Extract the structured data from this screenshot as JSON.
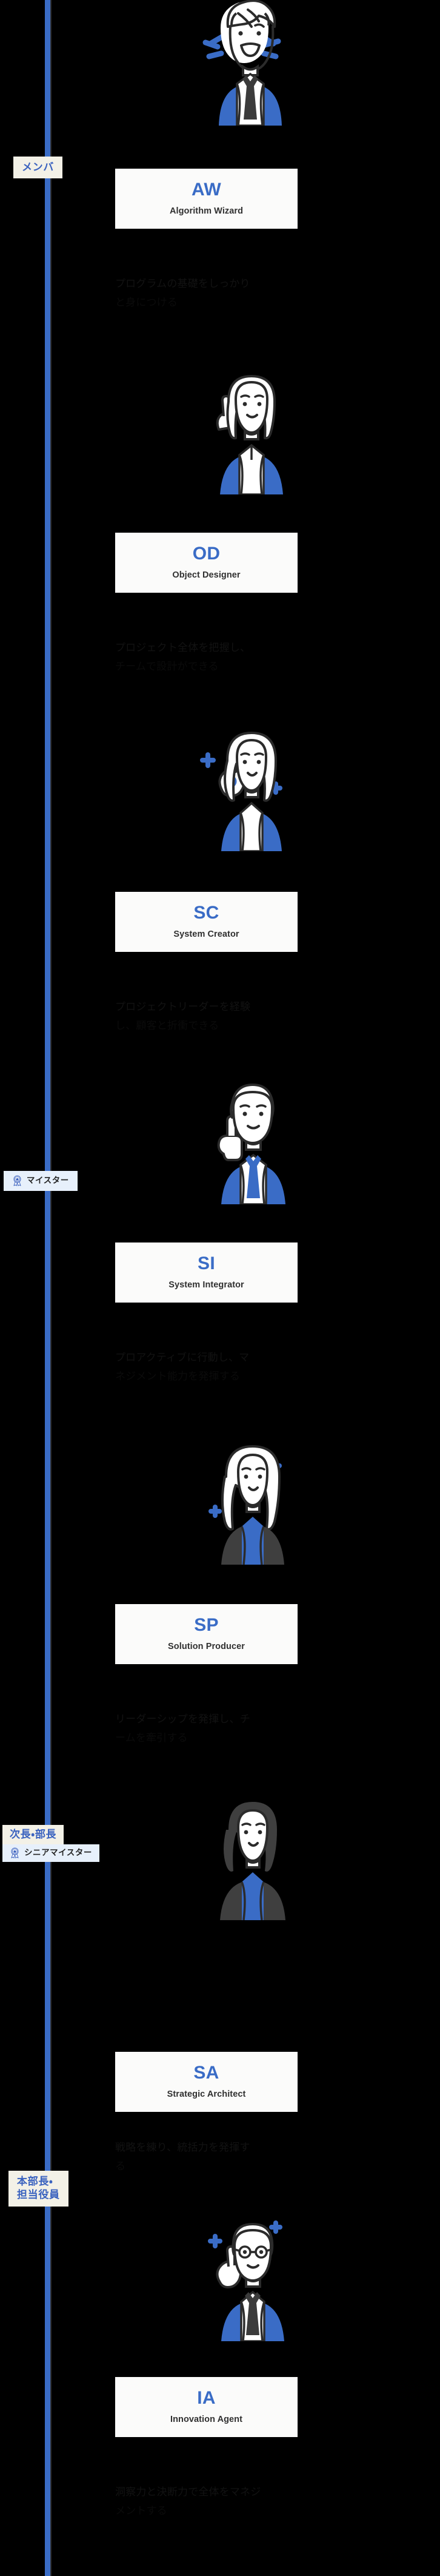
{
  "page": {
    "title": "キャリアステップ",
    "background_color": "#000000",
    "accent_color": "#3a6cc6",
    "rail_color": "#3a6cc6",
    "badge_cream_bg": "#f3f1e7",
    "badge_cream_text": "#3a62bf",
    "badge_ice_bg": "#e7f0fb",
    "badge_ice_text": "#232323",
    "card_bg": "#fbfbfa",
    "card_abbr_color": "#3a6cc6",
    "card_name_color": "#303030"
  },
  "badges": [
    {
      "id": "member",
      "rows": [
        {
          "style": "cream",
          "label": "メンバ",
          "icon": null
        }
      ]
    },
    {
      "id": "meister",
      "rows": [
        {
          "style": "ice",
          "label": "マイスター",
          "icon": "medal-ribbon-icon"
        }
      ]
    },
    {
      "id": "senior-meister",
      "rows": [
        {
          "style": "cream",
          "label": "次長・部長",
          "icon": null
        },
        {
          "style": "ice",
          "label": "シニアマイスター",
          "icon": "medal-ribbon-icon"
        }
      ]
    },
    {
      "id": "executive",
      "rows": [
        {
          "style": "cream",
          "label_line1": "本部長・",
          "label_line2": "担当役員",
          "icon": null
        }
      ]
    }
  ],
  "roles": [
    {
      "abbr": "AW",
      "name": "Algorithm Wizard",
      "desc_line1": "プログラムの基礎をしっかり",
      "desc_line2": "と身につける",
      "avatar": "avatar-excited-man-icon"
    },
    {
      "abbr": "OD",
      "name": "Object Designer",
      "desc_line1": "プロジェクト全体を把握し、",
      "desc_line2": "チームで設計ができる",
      "avatar": "avatar-pointing-woman-icon"
    },
    {
      "abbr": "SC",
      "name": "System Creator",
      "desc_line1": "プロジェクトリーダーを経験",
      "desc_line2": "し、顧客と折衝できる",
      "avatar": "avatar-ok-sign-woman-icon"
    },
    {
      "abbr": "SI",
      "name": "System Integrator",
      "desc_line1": "プロアクティブに行動し、マ",
      "desc_line2": "ネジメント能力を発揮する",
      "avatar": "avatar-thumbs-up-man-icon"
    },
    {
      "abbr": "SP",
      "name": "Solution Producer",
      "desc_line1": "リーダーシップを発揮し、チ",
      "desc_line2": "ームを牽引する",
      "avatar": "avatar-confident-woman-icon"
    },
    {
      "abbr": "SA",
      "name": "Strategic Architect",
      "desc_line1": "戦略を練り、統括力を発揮す",
      "desc_line2": "る",
      "avatar": "avatar-suited-woman-icon"
    },
    {
      "abbr": "IA",
      "name": "Innovation Agent",
      "desc_line1": "洞察力と決断力で全体をマネジ",
      "desc_line2": "メントする",
      "avatar": "avatar-senior-man-icon"
    }
  ]
}
